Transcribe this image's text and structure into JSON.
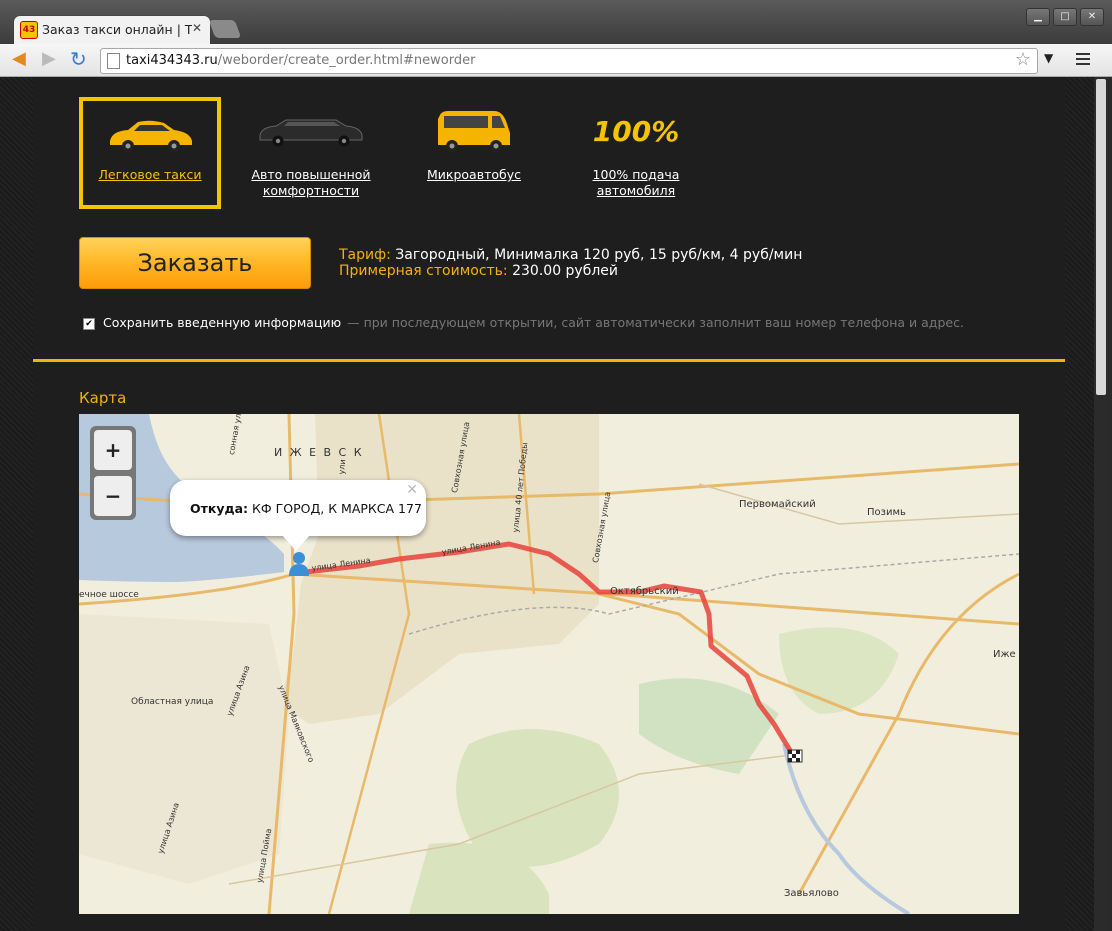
{
  "browser": {
    "tab_title": "Заказ такси онлайн | Т",
    "favicon_text": "43",
    "url_host": "taxi434343.ru",
    "url_path": "/weborder/create_order.html#neworder"
  },
  "services": [
    {
      "label_1": "Легковое такси",
      "label_2": "",
      "selected": true
    },
    {
      "label_1": "Авто повышенной",
      "label_2": "комфортности",
      "selected": false
    },
    {
      "label_1": "Микроавтобус",
      "label_2": "",
      "selected": false
    },
    {
      "label_1": "100% подача",
      "label_2": "автомобиля",
      "badge": "100%",
      "selected": false
    }
  ],
  "order": {
    "button_label": "Заказать",
    "tariff_label": "Тариф:",
    "tariff_value": "Загородный, Минималка 120 руб, 15 руб/км, 4 руб/мин",
    "cost_label": "Примерная стоимость:",
    "cost_value": "230.00 рублей"
  },
  "save": {
    "checked": true,
    "label": "Сохранить введенную информацию",
    "hint": "— при последующем открытии, сайт автоматически заполнит ваш номер телефона и адрес."
  },
  "map": {
    "title": "Карта",
    "zoom_in": "+",
    "zoom_out": "−",
    "popup_label": "Откуда:",
    "popup_value": "КФ ГОРОД, К МАРКСА 177",
    "labels": {
      "city": "И Ж Е В С К",
      "pervomaysky": "Первомайский",
      "pozim": "Позимь",
      "oktyabrsky": "Октябрьский",
      "izhevsk_edge": "Иже",
      "zavyalovo": "Завьялово",
      "lenina_1": "улица Ленина",
      "lenina_2": "улица Ленина",
      "sovkhoznaya_1": "Совхозная улица",
      "sovkhoznaya_2": "Совхозная улица",
      "pobedy": "улица 40 лет Победы",
      "oblastnaya": "Областная улица",
      "azina_1": "улица Азина",
      "azina_2": "улица Азина",
      "mayakovskogo": "улица Маяковского",
      "poima": "улица Пойма",
      "shosse": "ечное шоссе",
      "sonnaya": "сонная улица",
      "uli": "ули"
    }
  },
  "colors": {
    "accent": "#f5b20c",
    "selected_border": "#f5c500",
    "route": "#e8423a"
  }
}
